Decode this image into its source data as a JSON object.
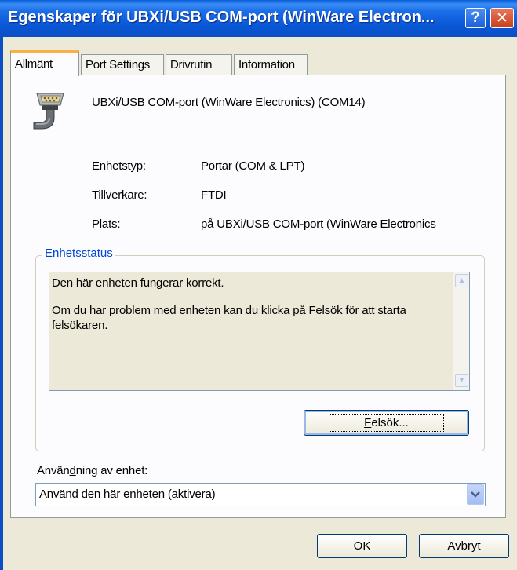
{
  "window": {
    "title": "Egenskaper för UBXi/USB COM-port (WinWare Electron...",
    "help_label": "?",
    "close_label": "✕"
  },
  "tabs": [
    {
      "label": "Allmänt",
      "active": true
    },
    {
      "label": "Port Settings",
      "active": false
    },
    {
      "label": "Drivrutin",
      "active": false
    },
    {
      "label": "Information",
      "active": false
    }
  ],
  "device": {
    "icon": "serial-port-connector-icon",
    "name": "UBXi/USB COM-port (WinWare Electronics) (COM14)"
  },
  "properties": [
    {
      "label": "Enhetstyp:",
      "value": "Portar (COM & LPT)"
    },
    {
      "label": "Tillverkare:",
      "value": "FTDI"
    },
    {
      "label": "Plats:",
      "value": "på UBXi/USB COM-port (WinWare Electronics"
    }
  ],
  "status": {
    "group_title": "Enhetsstatus",
    "line1": "Den här enheten fungerar korrekt.",
    "line2": "Om du har problem med enheten kan du klicka på Felsök för att starta felsökaren.",
    "troubleshoot_prefix": "F",
    "troubleshoot_rest": "elsök..."
  },
  "usage": {
    "label_before": "Använ",
    "label_underlined": "d",
    "label_after": "ning av enhet:",
    "selected": "Använd den här enheten (aktivera)"
  },
  "buttons": {
    "ok": "OK",
    "cancel": "Avbryt"
  },
  "colors": {
    "titlebar": "#0a5fd9",
    "dialog_bg": "#ece9d8",
    "group_title": "#0046d5",
    "active_tab_accent": "#f9b044"
  }
}
